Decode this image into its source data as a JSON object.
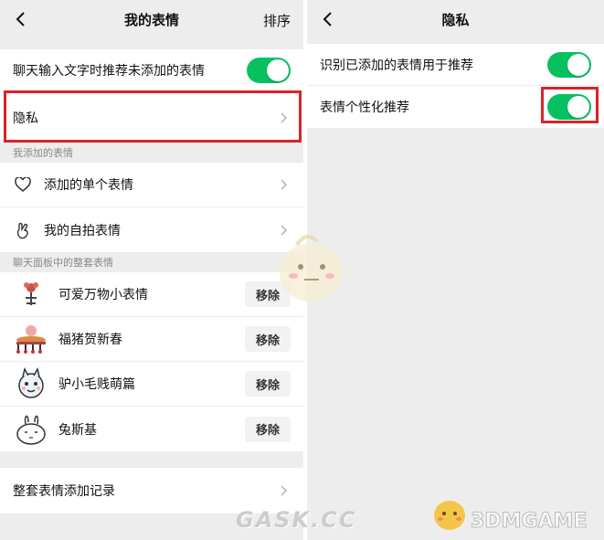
{
  "left": {
    "title": "我的表情",
    "right_action": "排序",
    "recommend_toggle_label": "聊天输入文字时推荐未添加的表情",
    "recommend_toggle_on": true,
    "privacy_label": "隐私",
    "section_added": "我添加的表情",
    "added_items": [
      {
        "label": "添加的单个表情",
        "icon": "heart-outline-icon"
      },
      {
        "label": "我的自拍表情",
        "icon": "selfie-hand-icon"
      }
    ],
    "section_packs": "聊天面板中的整套表情",
    "packs": [
      {
        "name": "可爱万物小表情",
        "action": "移除"
      },
      {
        "name": "福猪贺新春",
        "action": "移除"
      },
      {
        "name": "驴小毛贱萌篇",
        "action": "移除"
      },
      {
        "name": "兔斯基",
        "action": "移除"
      }
    ],
    "history_label": "整套表情添加记录"
  },
  "right": {
    "title": "隐私",
    "items": [
      {
        "label": "识别已添加的表情用于推荐",
        "on": true
      },
      {
        "label": "表情个性化推荐",
        "on": true
      }
    ]
  },
  "colors": {
    "toggle_on": "#07c160",
    "highlight": "#d9232a",
    "background": "#ededed"
  },
  "watermarks": {
    "center_text": "GASK.CC",
    "corner_text": "3DMGAME"
  }
}
